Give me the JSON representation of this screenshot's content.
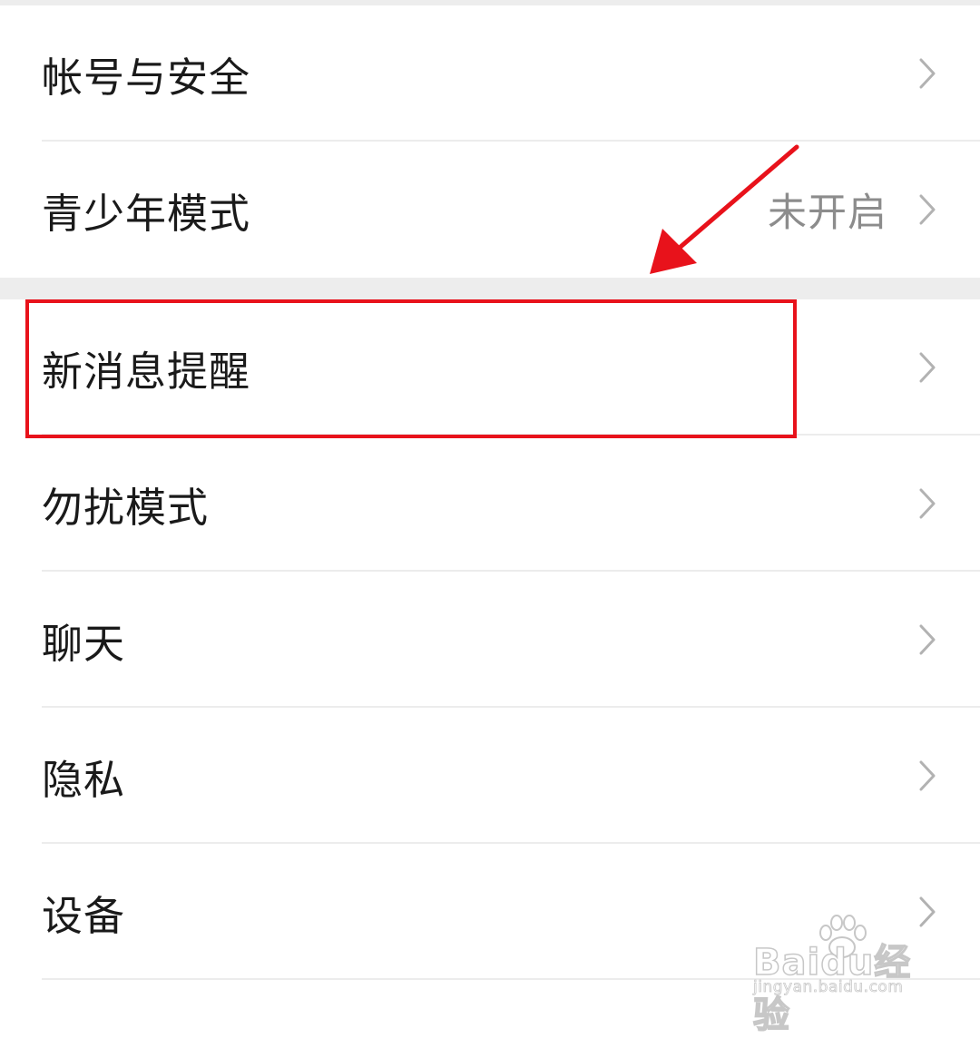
{
  "settings": {
    "groups": [
      {
        "items": [
          {
            "label": "帐号与安全",
            "value": ""
          },
          {
            "label": "青少年模式",
            "value": "未开启"
          }
        ]
      },
      {
        "items": [
          {
            "label": "新消息提醒",
            "value": ""
          },
          {
            "label": "勿扰模式",
            "value": ""
          },
          {
            "label": "聊天",
            "value": ""
          },
          {
            "label": "隐私",
            "value": ""
          },
          {
            "label": "设备",
            "value": ""
          }
        ]
      }
    ]
  },
  "annotation": {
    "highlight_color": "#e8121b",
    "highlighted_item": "新消息提醒"
  },
  "watermark": {
    "brand": "Baidu经验",
    "url": "jingyan.baidu.com"
  },
  "icons": {
    "row_chevron": "chevron-right-icon",
    "watermark_paw": "paw-icon"
  }
}
